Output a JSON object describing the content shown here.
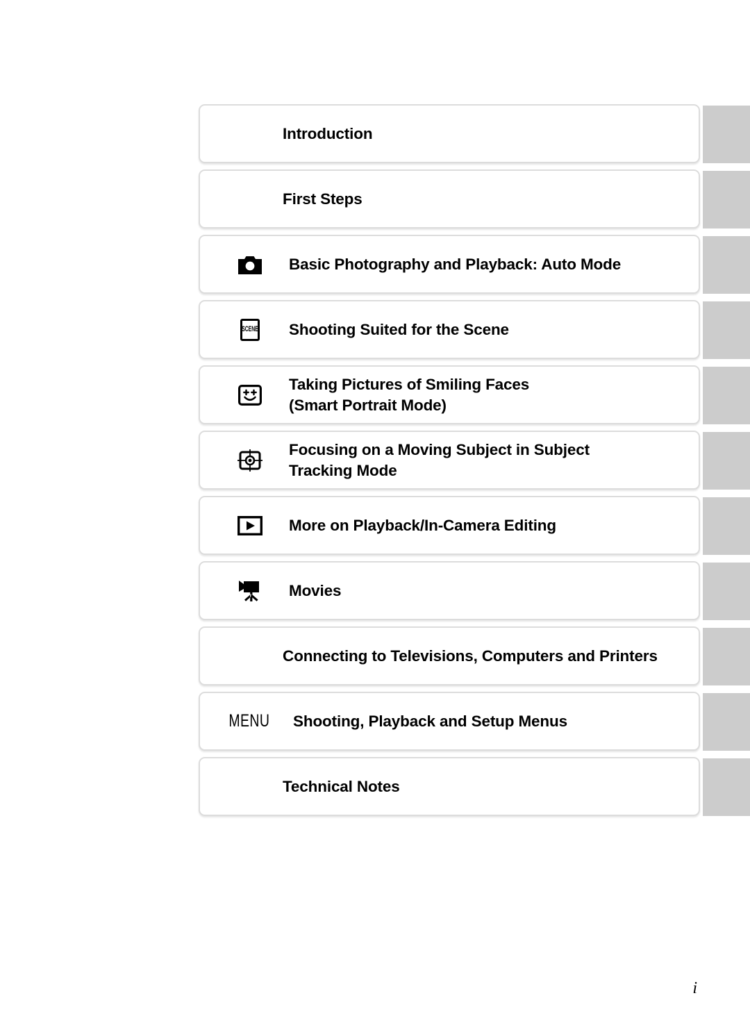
{
  "document": {
    "type": "table-of-contents",
    "page_number": "i",
    "tab_color": "#cccccc",
    "card_color": "#ffffff",
    "border_color": "#dcdcdc",
    "text_color": "#000000"
  },
  "contents": {
    "rows": [
      {
        "icon": null,
        "icon_name": "none",
        "title": "Introduction"
      },
      {
        "icon": null,
        "icon_name": "none",
        "title": "First Steps"
      },
      {
        "icon": "camera",
        "icon_name": "camera-icon",
        "title": "Basic Photography and Playback: Auto Mode"
      },
      {
        "icon": "scene",
        "icon_name": "scene-mode-icon",
        "icon_label": "SCENE",
        "title": "Shooting Suited for the Scene"
      },
      {
        "icon": "smile",
        "icon_name": "smiling-face-icon",
        "title": "Taking Pictures of Smiling Faces\n(Smart Portrait Mode)"
      },
      {
        "icon": "target",
        "icon_name": "subject-tracking-target-icon",
        "title": "Focusing on a Moving Subject in Subject\nTracking Mode"
      },
      {
        "icon": "play",
        "icon_name": "playback-icon",
        "title": "More on Playback/In-Camera Editing"
      },
      {
        "icon": "movie",
        "icon_name": "movie-camera-icon",
        "title": "Movies"
      },
      {
        "icon": null,
        "icon_name": "none",
        "title": "Connecting to Televisions, Computers and Printers"
      },
      {
        "icon": "menu",
        "icon_name": "menu-button-icon",
        "icon_label": "MENU",
        "title": "Shooting, Playback and Setup Menus"
      },
      {
        "icon": null,
        "icon_name": "none",
        "title": "Technical Notes"
      }
    ]
  }
}
